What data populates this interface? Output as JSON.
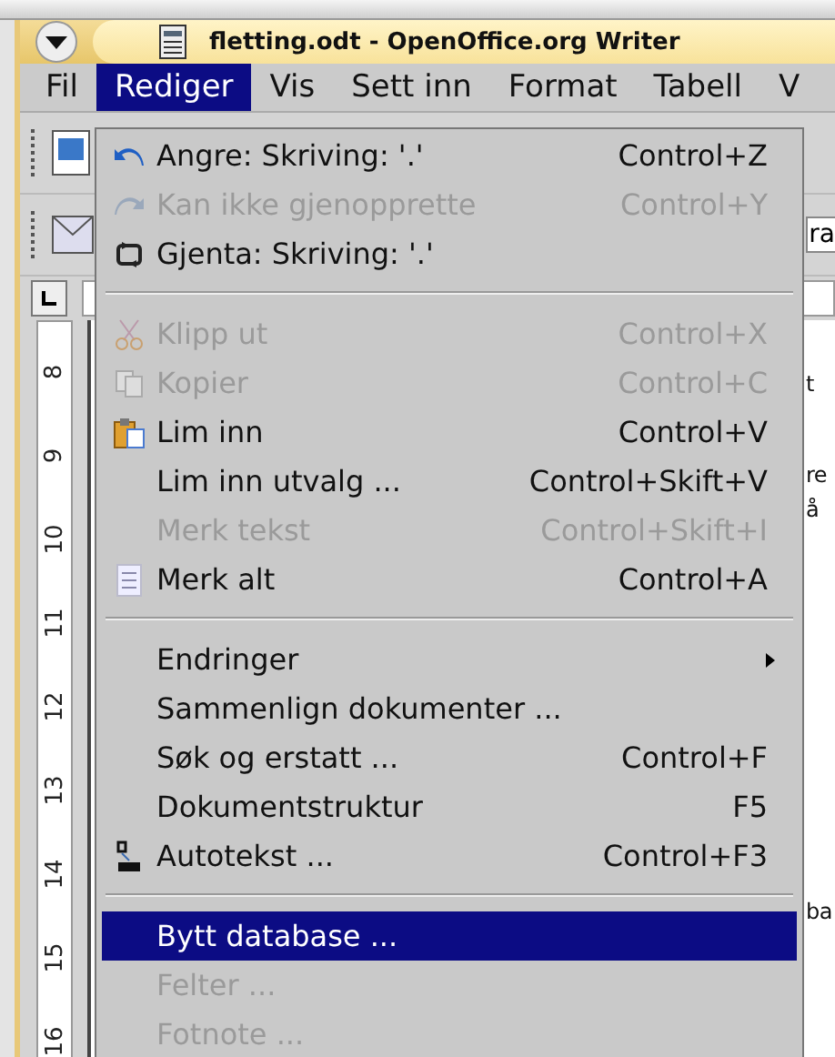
{
  "window": {
    "title": "fletting.odt - OpenOffice.org Writer"
  },
  "menu_bar": [
    {
      "label": "Fil",
      "selected": false
    },
    {
      "label": "Rediger",
      "selected": true
    },
    {
      "label": "Vis",
      "selected": false
    },
    {
      "label": "Sett inn",
      "selected": false
    },
    {
      "label": "Format",
      "selected": false
    },
    {
      "label": "Tabell",
      "selected": false
    },
    {
      "label": "V",
      "selected": false
    }
  ],
  "toolbar": {
    "field_value": "ra"
  },
  "ruler": {
    "numbers": [
      "8",
      "9",
      "10",
      "11",
      "12",
      "13",
      "14",
      "15",
      "16"
    ]
  },
  "document": {
    "fragments": [
      "t",
      "re",
      "å",
      "ba"
    ]
  },
  "edit_menu": [
    {
      "kind": "item",
      "label": "Angre: Skriving: '.'",
      "shortcut": "Control+Z",
      "disabled": false,
      "selected": false,
      "submenu": false
    },
    {
      "kind": "item",
      "label": "Kan ikke gjenopprette",
      "shortcut": "Control+Y",
      "disabled": true,
      "selected": false,
      "submenu": false
    },
    {
      "kind": "item",
      "label": "Gjenta: Skriving: '.'",
      "disabled": false,
      "selected": false,
      "submenu": false
    },
    {
      "kind": "separator"
    },
    {
      "kind": "item",
      "label": "Klipp ut",
      "shortcut": "Control+X",
      "disabled": true,
      "selected": false,
      "submenu": false
    },
    {
      "kind": "item",
      "label": "Kopier",
      "shortcut": "Control+C",
      "disabled": true,
      "selected": false,
      "submenu": false
    },
    {
      "kind": "item",
      "label": "Lim inn",
      "shortcut": "Control+V",
      "disabled": false,
      "selected": false,
      "submenu": false
    },
    {
      "kind": "item",
      "label": "Lim inn utvalg ...",
      "shortcut": "Control+Skift+V",
      "disabled": false,
      "selected": false,
      "submenu": false
    },
    {
      "kind": "item",
      "label": "Merk tekst",
      "shortcut": "Control+Skift+I",
      "disabled": true,
      "selected": false,
      "submenu": false
    },
    {
      "kind": "item",
      "label": "Merk alt",
      "shortcut": "Control+A",
      "disabled": false,
      "selected": false,
      "submenu": false
    },
    {
      "kind": "separator"
    },
    {
      "kind": "item",
      "label": "Endringer",
      "disabled": false,
      "selected": false,
      "submenu": true
    },
    {
      "kind": "item",
      "label": "Sammenlign dokumenter ...",
      "disabled": false,
      "selected": false,
      "submenu": false
    },
    {
      "kind": "item",
      "label": "Søk og erstatt ...",
      "shortcut": "Control+F",
      "disabled": false,
      "selected": false,
      "submenu": false
    },
    {
      "kind": "item",
      "label": "Dokumentstruktur",
      "shortcut": "F5",
      "disabled": false,
      "selected": false,
      "submenu": false
    },
    {
      "kind": "item",
      "label": "Autotekst ...",
      "shortcut": "Control+F3",
      "disabled": false,
      "selected": false,
      "submenu": false
    },
    {
      "kind": "separator"
    },
    {
      "kind": "item",
      "label": "Bytt database ...",
      "disabled": false,
      "selected": true,
      "submenu": false
    },
    {
      "kind": "item",
      "label": "Felter ...",
      "disabled": true,
      "selected": false,
      "submenu": false
    },
    {
      "kind": "item",
      "label": "Fotnote ...",
      "disabled": true,
      "selected": false,
      "submenu": false
    }
  ]
}
